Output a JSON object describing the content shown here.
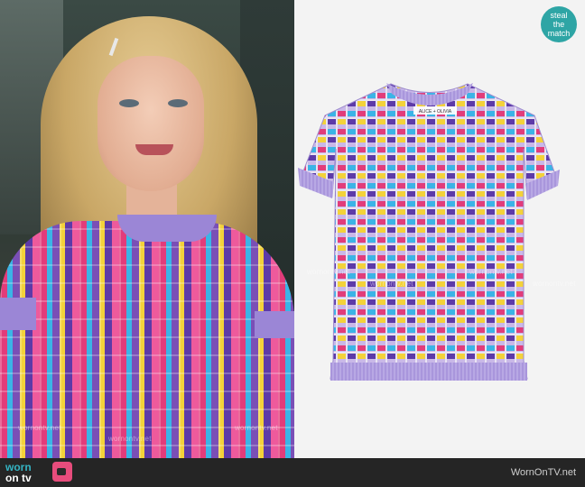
{
  "badge": {
    "line1": "steal",
    "line2": "the",
    "line3": "match"
  },
  "brand_tag": "ALICE + OLIVIA",
  "watermark": "wornontv.net",
  "footer": {
    "logo_worn": "worn",
    "logo_on": "on tv",
    "site": "WornOnTV.net"
  },
  "colors": {
    "sweater_base": "#8a68c9",
    "collar": "#9b86d6",
    "badge": "#2ea5a5",
    "footer": "#252525",
    "logo_teal": "#34b3c3"
  }
}
